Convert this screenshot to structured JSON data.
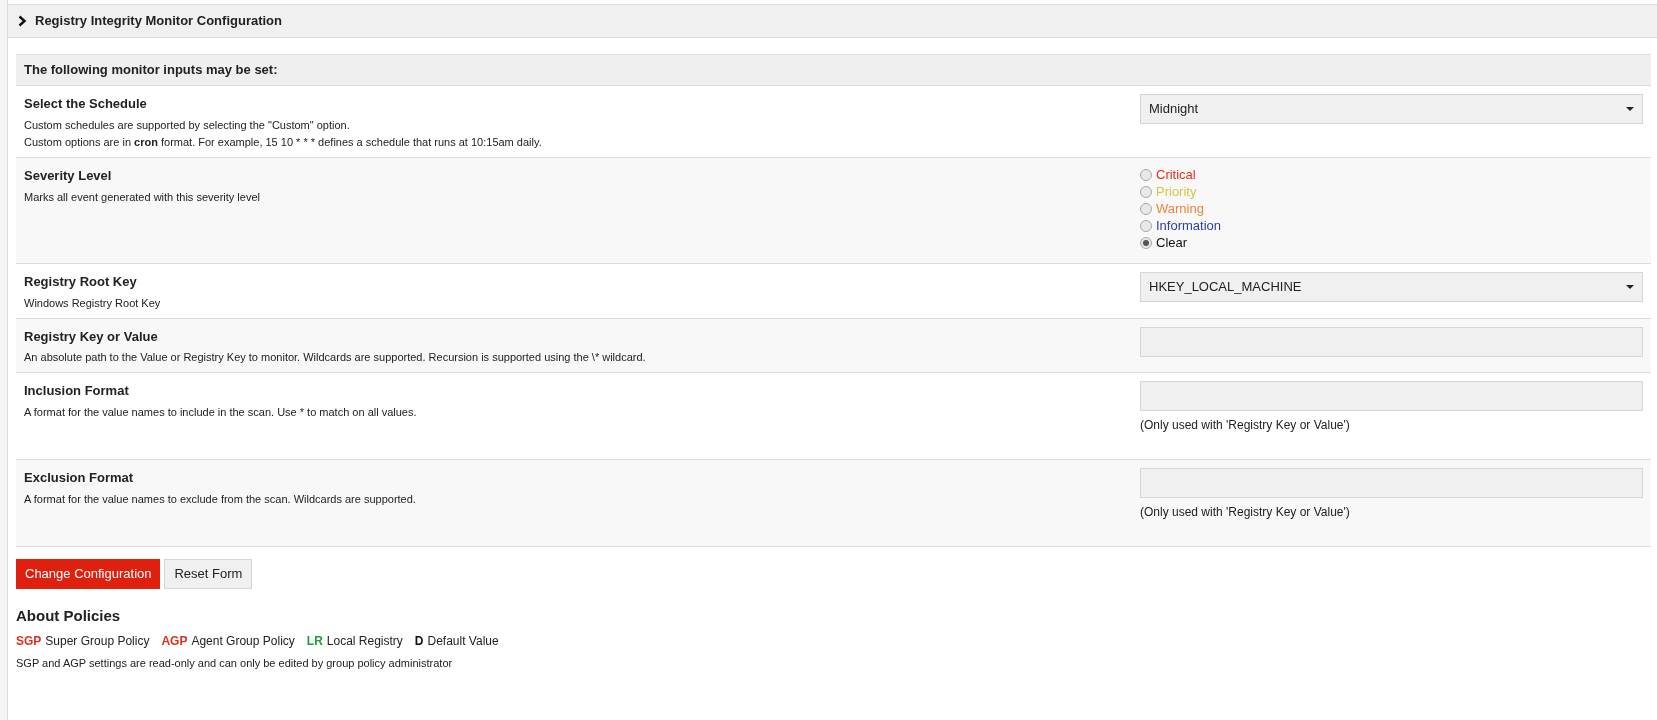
{
  "panel": {
    "title": "Registry Integrity Monitor Configuration",
    "expanded": false
  },
  "form": {
    "heading": "The following monitor inputs may be set:",
    "rows": [
      {
        "kind": "select",
        "label": "Select the Schedule",
        "description": [
          "Custom schedules are supported by selecting the \"Custom\" option.",
          "Custom options are in **cron** format. For example, 15 10 * * * defines a schedule that runs at 10:15am daily."
        ],
        "value": "Midnight"
      },
      {
        "kind": "radio",
        "label": "Severity Level",
        "description": [
          "Marks all event generated with this severity level"
        ],
        "options": [
          {
            "label": "Critical",
            "color": "#e0301e",
            "selected": false
          },
          {
            "label": "Priority",
            "color": "#d4c64a",
            "selected": false
          },
          {
            "label": "Warning",
            "color": "#f0843c",
            "selected": false
          },
          {
            "label": "Information",
            "color": "#2e3fa8",
            "selected": false
          },
          {
            "label": "Clear",
            "color": "#111111",
            "selected": true
          }
        ]
      },
      {
        "kind": "select",
        "label": "Registry Root Key",
        "description": [
          "Windows Registry Root Key"
        ],
        "value": "HKEY_LOCAL_MACHINE"
      },
      {
        "kind": "text",
        "label": "Registry Key or Value",
        "description": [
          "An absolute path to the Value or Registry Key to monitor. Wildcards are supported. Recursion is supported using the \\* wildcard."
        ]
      },
      {
        "kind": "text",
        "label": "Inclusion Format",
        "description": [
          "A format for the value names to include in the scan. Use * to match on all values."
        ],
        "note": "(Only used with 'Registry Key or Value')"
      },
      {
        "kind": "text",
        "label": "Exclusion Format",
        "description": [
          "A format for the value names to exclude from the scan. Wildcards are supported."
        ],
        "note": "(Only used with 'Registry Key or Value')"
      }
    ]
  },
  "buttons": [
    {
      "label": "Change Configuration",
      "kind": "primary"
    },
    {
      "label": "Reset Form",
      "kind": "secondary"
    }
  ],
  "about": {
    "title": "About Policies",
    "legend": [
      {
        "code": "SGP",
        "color": "#e0301e",
        "text": "Super Group Policy"
      },
      {
        "code": "AGP",
        "color": "#e0301e",
        "text": "Agent Group Policy"
      },
      {
        "code": "LR",
        "color": "#1e9e3e",
        "text": "Local Registry"
      },
      {
        "code": "D",
        "color": "#111111",
        "text": "Default Value"
      }
    ],
    "note": "SGP and AGP settings are read-only and can only be edited by group policy administrator"
  }
}
